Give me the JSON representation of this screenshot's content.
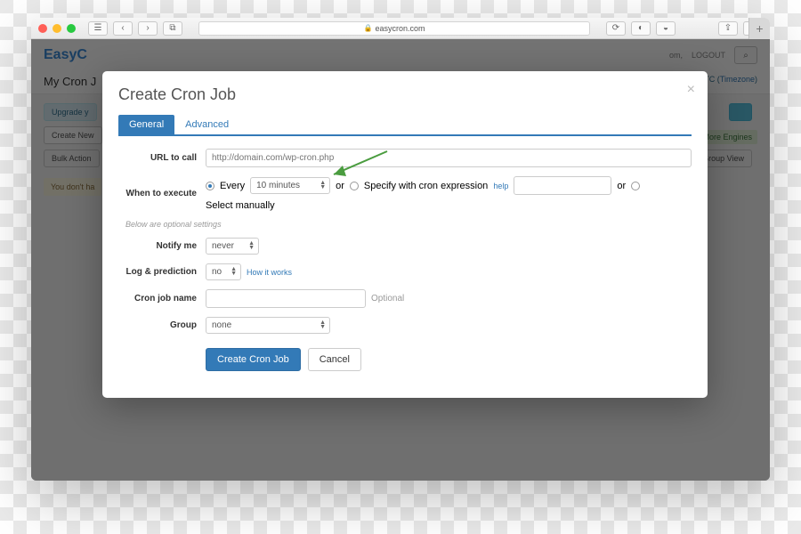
{
  "browser": {
    "url": "easycron.com"
  },
  "bg": {
    "logo_a": "Easy",
    "logo_b": "C",
    "logout": "LOGOUT",
    "account_suffix": "om,",
    "subtitle": "My Cron J",
    "upgrade": "Upgrade y",
    "create": "Create New",
    "bulk": "Bulk Action",
    "note": "You don't ha",
    "timezone": "Timezone",
    "tc": "TC (",
    "more": "d More Engines",
    "group": "Group View"
  },
  "modal": {
    "title": "Create Cron Job",
    "tabs": {
      "general": "General",
      "advanced": "Advanced"
    },
    "url_label": "URL to call",
    "url_placeholder": "http://domain.com/wp-cron.php",
    "when_label": "When to execute",
    "every": "Every",
    "interval": "10 minutes",
    "or1": "or",
    "specify": "Specify with cron expression",
    "help": "help",
    "or2": "or",
    "manual": "Select manually",
    "hint": "Below are optional settings",
    "notify_label": "Notify me",
    "notify_val": "never",
    "log_label": "Log & prediction",
    "log_val": "no",
    "how": "How it works",
    "name_label": "Cron job name",
    "optional": "Optional",
    "group_label": "Group",
    "group_val": "none",
    "submit": "Create Cron Job",
    "cancel": "Cancel"
  }
}
